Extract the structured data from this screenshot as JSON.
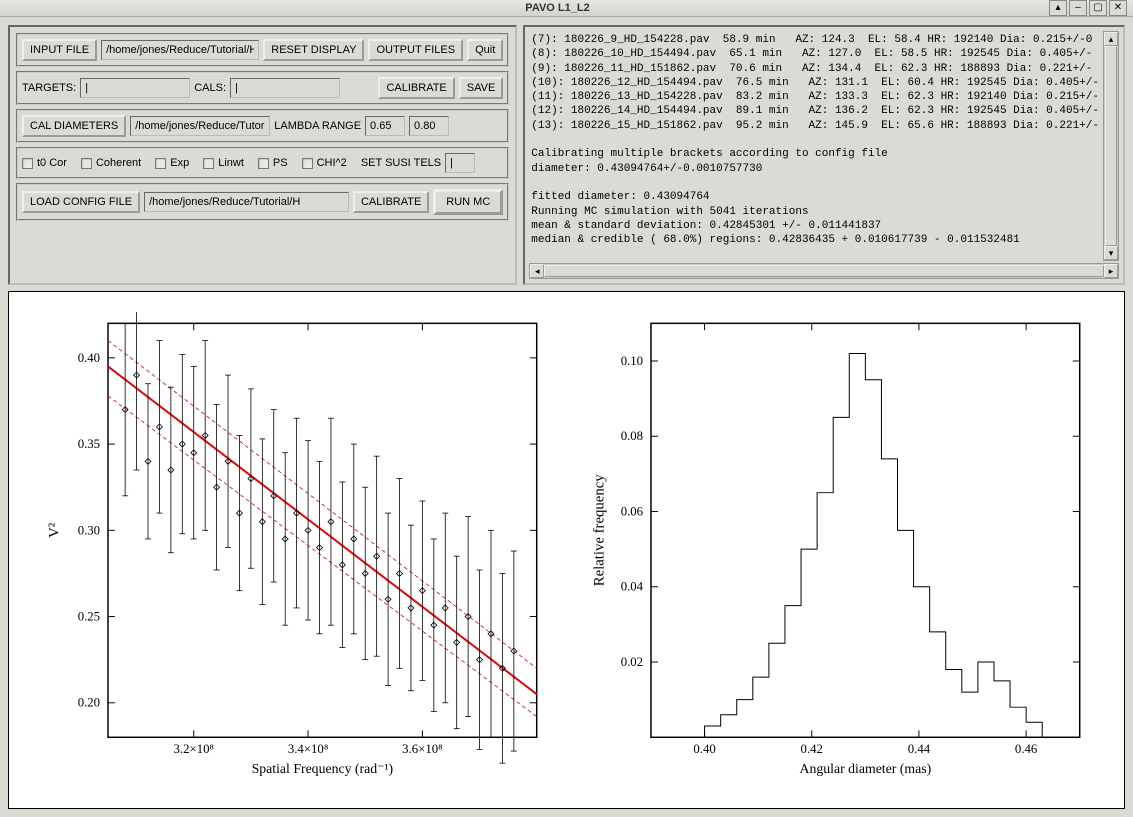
{
  "window": {
    "title": "PAVO L1_L2"
  },
  "row1": {
    "input_file": "INPUT FILE",
    "path": "/home/jones/Reduce/Tutorial/H",
    "reset": "RESET DISPLAY",
    "output": "OUTPUT FILES",
    "quit": "Quit"
  },
  "row2": {
    "targets": "TARGETS:",
    "targets_val": "|",
    "cals": "CALS:",
    "cals_val": "|",
    "calibrate": "CALIBRATE",
    "save": "SAVE"
  },
  "row3": {
    "cal_dia": "CAL DIAMETERS",
    "path": "/home/jones/Reduce/Tutor",
    "lambda": "LAMBDA RANGE",
    "v1": "0.65",
    "v2": "0.80"
  },
  "row4": {
    "items": [
      "t0 Cor",
      "Coherent",
      "Exp",
      "Linwt",
      "PS",
      "CHI^2"
    ],
    "susi": "SET SUSI TELS",
    "susi_val": "|"
  },
  "row5": {
    "load": "LOAD CONFIG FILE",
    "path": "/home/jones/Reduce/Tutorial/H",
    "calibrate": "CALIBRATE",
    "run": "RUN MC"
  },
  "log_lines": [
    "(7): 180226_9_HD_154228.pav  58.9 min   AZ: 124.3  EL: 58.4 HR: 192140 Dia: 0.215+/-0",
    "(8): 180226_10_HD_154494.pav  65.1 min   AZ: 127.0  EL: 58.5 HR: 192545 Dia: 0.405+/-",
    "(9): 180226_11_HD_151862.pav  70.6 min   AZ: 134.4  EL: 62.3 HR: 188893 Dia: 0.221+/-",
    "(10): 180226_12_HD_154494.pav  76.5 min   AZ: 131.1  EL: 60.4 HR: 192545 Dia: 0.405+/-",
    "(11): 180226_13_HD_154228.pav  83.2 min   AZ: 133.3  EL: 62.3 HR: 192140 Dia: 0.215+/-",
    "(12): 180226_14_HD_154494.pav  89.1 min   AZ: 136.2  EL: 62.3 HR: 192545 Dia: 0.405+/-",
    "(13): 180226_15_HD_151862.pav  95.2 min   AZ: 145.9  EL: 65.6 HR: 188893 Dia: 0.221+/-",
    "",
    "Calibrating multiple brackets according to config file",
    "diameter: 0.43094764+/-0.0010757730",
    "",
    "fitted diameter: 0.43094764",
    "Running MC simulation with 5041 iterations",
    "mean & standard deviation: 0.42845301 +/- 0.011441837",
    "median & credible ( 68.0%) regions: 0.42836435 + 0.010617739 - 0.011532481"
  ],
  "chart_data": [
    {
      "type": "scatter",
      "title": "",
      "xlabel": "Spatial Frequency (rad⁻¹)",
      "ylabel": "V²",
      "xlim": [
        305000000.0,
        380000000.0
      ],
      "ylim": [
        0.18,
        0.42
      ],
      "xticks": [
        320000000.0,
        340000000.0,
        360000000.0
      ],
      "yticks": [
        0.2,
        0.25,
        0.3,
        0.35,
        0.4
      ],
      "fit_line": {
        "x": [
          305000000.0,
          380000000.0
        ],
        "y": [
          0.395,
          0.205
        ]
      },
      "fit_upper": {
        "x": [
          305000000.0,
          380000000.0
        ],
        "y": [
          0.41,
          0.22
        ]
      },
      "fit_lower": {
        "x": [
          305000000.0,
          380000000.0
        ],
        "y": [
          0.378,
          0.192
        ]
      },
      "data": [
        {
          "x": 308000000.0,
          "y": 0.37,
          "err": 0.05
        },
        {
          "x": 310000000.0,
          "y": 0.39,
          "err": 0.055
        },
        {
          "x": 312000000.0,
          "y": 0.34,
          "err": 0.045
        },
        {
          "x": 314000000.0,
          "y": 0.36,
          "err": 0.05
        },
        {
          "x": 316000000.0,
          "y": 0.335,
          "err": 0.048
        },
        {
          "x": 318000000.0,
          "y": 0.35,
          "err": 0.052
        },
        {
          "x": 320000000.0,
          "y": 0.345,
          "err": 0.05
        },
        {
          "x": 322000000.0,
          "y": 0.355,
          "err": 0.055
        },
        {
          "x": 324000000.0,
          "y": 0.325,
          "err": 0.048
        },
        {
          "x": 326000000.0,
          "y": 0.34,
          "err": 0.05
        },
        {
          "x": 328000000.0,
          "y": 0.31,
          "err": 0.045
        },
        {
          "x": 330000000.0,
          "y": 0.33,
          "err": 0.052
        },
        {
          "x": 332000000.0,
          "y": 0.305,
          "err": 0.048
        },
        {
          "x": 334000000.0,
          "y": 0.32,
          "err": 0.05
        },
        {
          "x": 336000000.0,
          "y": 0.295,
          "err": 0.05
        },
        {
          "x": 338000000.0,
          "y": 0.31,
          "err": 0.055
        },
        {
          "x": 340000000.0,
          "y": 0.3,
          "err": 0.052
        },
        {
          "x": 342000000.0,
          "y": 0.29,
          "err": 0.05
        },
        {
          "x": 344000000.0,
          "y": 0.305,
          "err": 0.06
        },
        {
          "x": 346000000.0,
          "y": 0.28,
          "err": 0.048
        },
        {
          "x": 348000000.0,
          "y": 0.295,
          "err": 0.055
        },
        {
          "x": 350000000.0,
          "y": 0.275,
          "err": 0.05
        },
        {
          "x": 352000000.0,
          "y": 0.285,
          "err": 0.058
        },
        {
          "x": 354000000.0,
          "y": 0.26,
          "err": 0.05
        },
        {
          "x": 356000000.0,
          "y": 0.275,
          "err": 0.055
        },
        {
          "x": 358000000.0,
          "y": 0.255,
          "err": 0.048
        },
        {
          "x": 360000000.0,
          "y": 0.265,
          "err": 0.052
        },
        {
          "x": 362000000.0,
          "y": 0.245,
          "err": 0.05
        },
        {
          "x": 364000000.0,
          "y": 0.255,
          "err": 0.055
        },
        {
          "x": 366000000.0,
          "y": 0.235,
          "err": 0.05
        },
        {
          "x": 368000000.0,
          "y": 0.25,
          "err": 0.058
        },
        {
          "x": 370000000.0,
          "y": 0.225,
          "err": 0.052
        },
        {
          "x": 372000000.0,
          "y": 0.24,
          "err": 0.06
        },
        {
          "x": 374000000.0,
          "y": 0.22,
          "err": 0.055
        },
        {
          "x": 376000000.0,
          "y": 0.23,
          "err": 0.058
        }
      ]
    },
    {
      "type": "bar",
      "title": "",
      "xlabel": "Angular diameter (mas)",
      "ylabel": "Relative frequency",
      "xlim": [
        0.39,
        0.47
      ],
      "ylim": [
        0.0,
        0.11
      ],
      "xticks": [
        0.4,
        0.42,
        0.44,
        0.46
      ],
      "yticks": [
        0.02,
        0.04,
        0.06,
        0.08,
        0.1
      ],
      "bin_width": 0.003,
      "bins": [
        {
          "x": 0.4,
          "y": 0.003
        },
        {
          "x": 0.403,
          "y": 0.006
        },
        {
          "x": 0.406,
          "y": 0.01
        },
        {
          "x": 0.409,
          "y": 0.016
        },
        {
          "x": 0.412,
          "y": 0.025
        },
        {
          "x": 0.415,
          "y": 0.035
        },
        {
          "x": 0.418,
          "y": 0.05
        },
        {
          "x": 0.421,
          "y": 0.065
        },
        {
          "x": 0.424,
          "y": 0.085
        },
        {
          "x": 0.427,
          "y": 0.102
        },
        {
          "x": 0.43,
          "y": 0.095
        },
        {
          "x": 0.433,
          "y": 0.074
        },
        {
          "x": 0.436,
          "y": 0.055
        },
        {
          "x": 0.439,
          "y": 0.04
        },
        {
          "x": 0.442,
          "y": 0.028
        },
        {
          "x": 0.445,
          "y": 0.018
        },
        {
          "x": 0.448,
          "y": 0.012
        },
        {
          "x": 0.451,
          "y": 0.02
        },
        {
          "x": 0.454,
          "y": 0.015
        },
        {
          "x": 0.457,
          "y": 0.008
        },
        {
          "x": 0.46,
          "y": 0.004
        }
      ]
    }
  ]
}
